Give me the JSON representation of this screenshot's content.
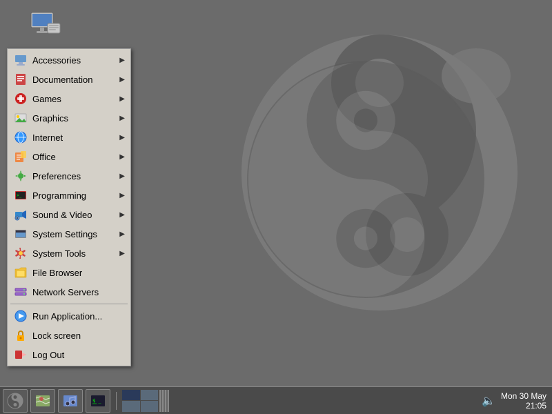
{
  "desktop": {
    "background_color": "#6b6b6b"
  },
  "menu": {
    "items": [
      {
        "label": "Accessories",
        "icon": "📁",
        "has_arrow": true,
        "name": "accessories"
      },
      {
        "label": "Documentation",
        "icon": "📄",
        "has_arrow": true,
        "name": "documentation"
      },
      {
        "label": "Games",
        "icon": "🎮",
        "has_arrow": true,
        "name": "games"
      },
      {
        "label": "Graphics",
        "icon": "🖼",
        "has_arrow": true,
        "name": "graphics"
      },
      {
        "label": "Internet",
        "icon": "🌐",
        "has_arrow": true,
        "name": "internet"
      },
      {
        "label": "Office",
        "icon": "📋",
        "has_arrow": true,
        "name": "office"
      },
      {
        "label": "Preferences",
        "icon": "⚙",
        "has_arrow": true,
        "name": "preferences"
      },
      {
        "label": "Programming",
        "icon": "💻",
        "has_arrow": true,
        "name": "programming"
      },
      {
        "label": "Sound & Video",
        "icon": "🔊",
        "has_arrow": true,
        "name": "sound-video"
      },
      {
        "label": "System Settings",
        "icon": "🖥",
        "has_arrow": true,
        "name": "system-settings"
      },
      {
        "label": "System Tools",
        "icon": "🔧",
        "has_arrow": true,
        "name": "system-tools"
      },
      {
        "label": "File Browser",
        "icon": "📂",
        "has_arrow": false,
        "name": "file-browser"
      },
      {
        "label": "Network Servers",
        "icon": "🖧",
        "has_arrow": false,
        "name": "network-servers"
      }
    ],
    "bottom_items": [
      {
        "label": "Run Application...",
        "icon": "▶",
        "name": "run-application"
      },
      {
        "label": "Lock screen",
        "icon": "🔒",
        "name": "lock-screen"
      },
      {
        "label": "Log Out",
        "icon": "🚪",
        "name": "log-out"
      }
    ]
  },
  "taskbar": {
    "clock_date": "Mon 30 May",
    "clock_time": "21:05"
  }
}
